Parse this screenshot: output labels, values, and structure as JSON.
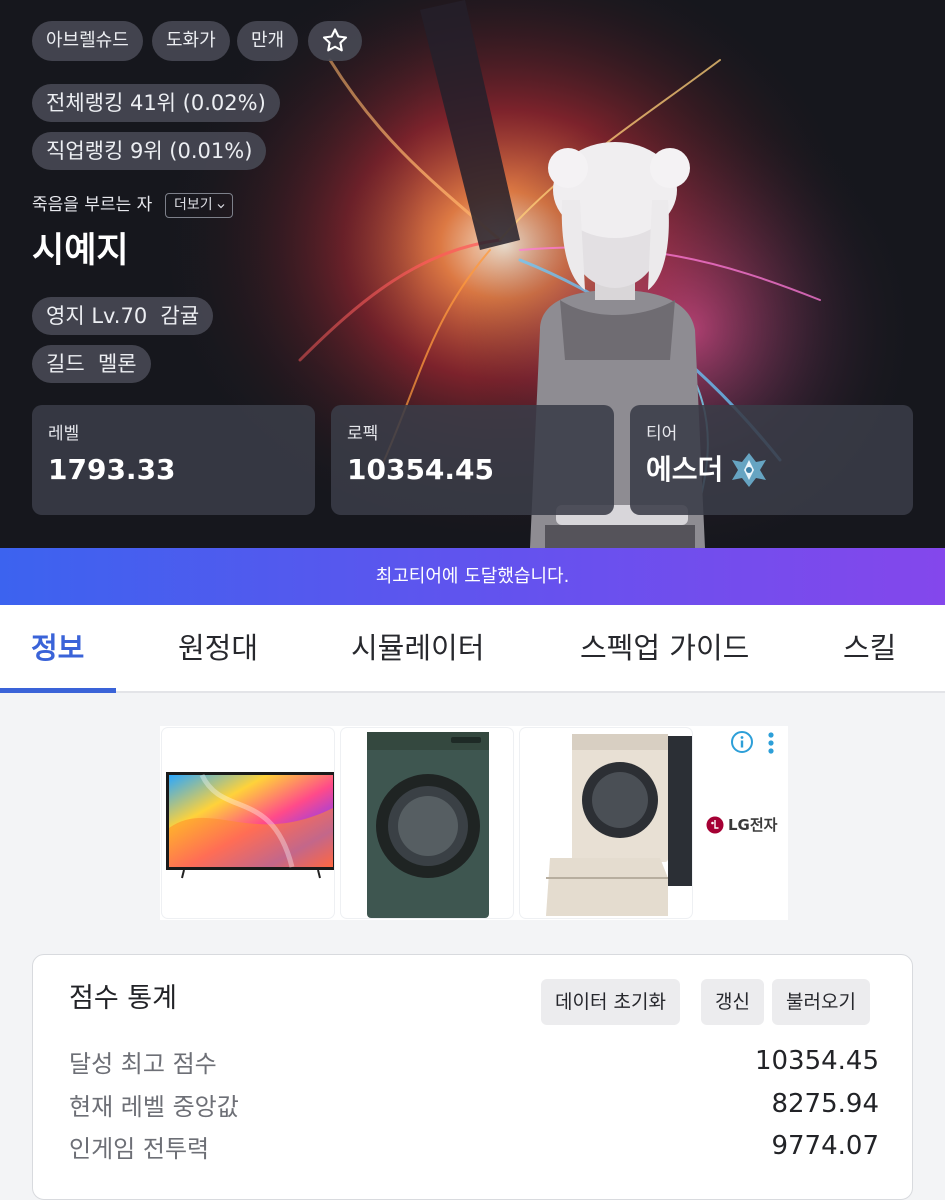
{
  "profile": {
    "tags": [
      "아브렐슈드",
      "도화가",
      "만개"
    ],
    "rankings": [
      "전체랭킹 41위 (0.02%)",
      "직업랭킹 9위 (0.01%)"
    ],
    "title": "죽음을 부르는 자",
    "more_label": "더보기",
    "name": "시예지",
    "estate": "영지 Lv.70  감귤",
    "guild": "길드  멜론"
  },
  "stats": [
    {
      "label": "레벨",
      "value": "1793.33"
    },
    {
      "label": "로펙",
      "value": "10354.45"
    },
    {
      "label": "티어",
      "value": "에스더"
    }
  ],
  "banner": {
    "text": "최고티어에 도달했습니다."
  },
  "tabs": [
    "정보",
    "원정대",
    "시뮬레이터",
    "스펙업 가이드",
    "스킬"
  ],
  "ad": {
    "brand": "LG전자"
  },
  "score_panel": {
    "title": "점수 통계",
    "buttons": [
      "데이터 초기화",
      "갱신",
      "불러오기"
    ],
    "rows": [
      {
        "label": "달성 최고 점수",
        "value": "10354.45"
      },
      {
        "label": "현재 레벨 중앙값",
        "value": "8275.94"
      },
      {
        "label": "인게임 전투력",
        "value": "9774.07"
      }
    ]
  },
  "colors": {
    "accent": "#3a63d8",
    "banner_start": "#3c63ef",
    "banner_end": "#8447ec",
    "hero_bg": "#16171d"
  }
}
